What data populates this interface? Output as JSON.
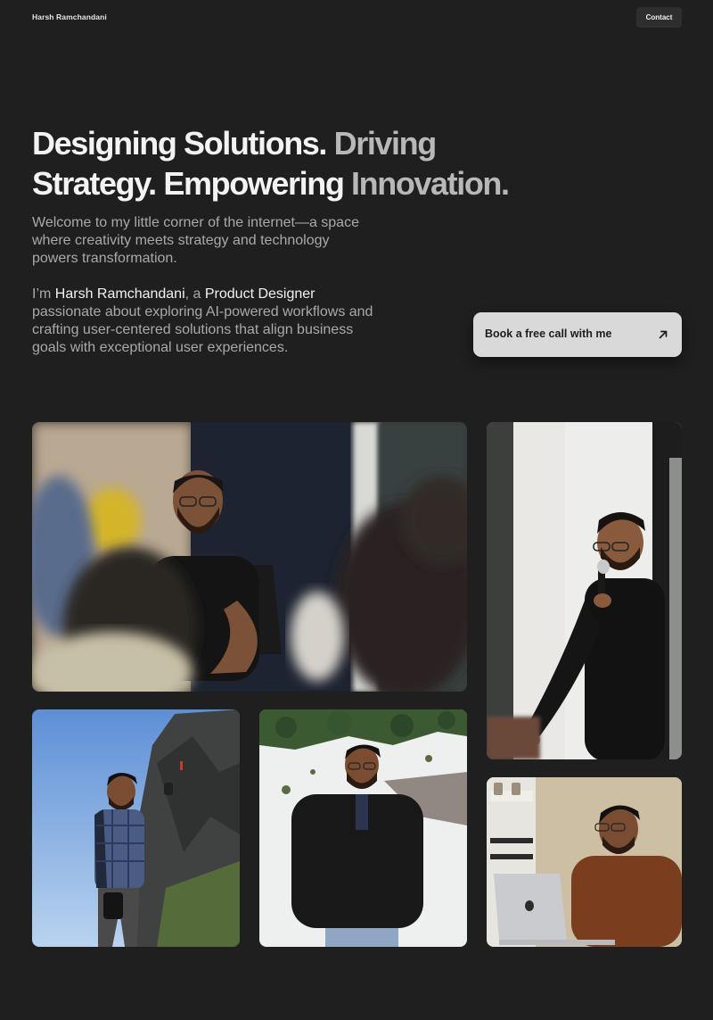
{
  "header": {
    "brand": "Harsh Ramchandani",
    "contact_label": "Contact"
  },
  "hero": {
    "title_parts": [
      {
        "text": "Designing ",
        "tone": "white"
      },
      {
        "text": "Solutions.",
        "tone": "white"
      },
      {
        "text": " Driving ",
        "tone": "grey"
      },
      {
        "text": "Strategy.",
        "tone": "white"
      },
      {
        "text": " Empowering ",
        "tone": "white"
      },
      {
        "text": "Innovation.",
        "tone": "grey"
      }
    ],
    "intro": "Welcome to my little corner of the internet—a space where creativity meets strategy and technology powers transformation.",
    "bio_prefix": "I’m ",
    "bio_name": "Harsh Ramchandani",
    "bio_mid": ", a ",
    "bio_role": "Product Designer",
    "bio_rest": " passionate about exploring AI-powered workflows and crafting user-centered solutions that align business goals with exceptional user experiences.",
    "cta_label": "Book a free call with me",
    "cta_icon": "arrow-up-right-icon"
  },
  "colors": {
    "background": "#1f1f1f",
    "title_white": "#f3f3f3",
    "title_grey": "#b8b8b8",
    "body_text": "#a9a9a9",
    "cta_bg": "#d9d9d9"
  },
  "gallery": {
    "photos": [
      {
        "name": "photo-speaking-workshop",
        "scene": "seated-discussion"
      },
      {
        "name": "photo-speaking-microphone",
        "scene": "presenting-with-mic"
      },
      {
        "name": "photo-hiking-cliff",
        "scene": "hiking"
      },
      {
        "name": "photo-snow-mountain",
        "scene": "snow"
      },
      {
        "name": "photo-working-laptop",
        "scene": "laptop"
      }
    ]
  }
}
